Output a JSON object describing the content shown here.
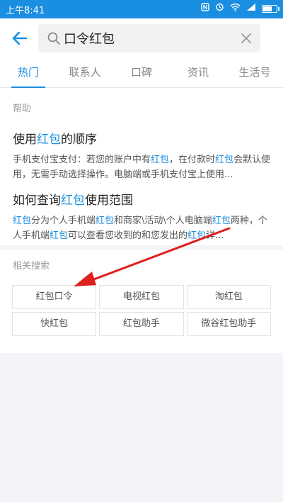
{
  "status_bar": {
    "time": "上午8:41",
    "icons": [
      "nfc-icon",
      "alarm-icon",
      "wifi-icon",
      "signal-icon",
      "battery-icon"
    ],
    "battery_level": 0.7
  },
  "search": {
    "query": "口令红包",
    "icon": "search-icon"
  },
  "tabs": [
    {
      "label": "热门",
      "active": true
    },
    {
      "label": "联系人"
    },
    {
      "label": "口碑"
    },
    {
      "label": "资讯"
    },
    {
      "label": "生活号"
    }
  ],
  "help": {
    "label": "帮助",
    "articles": [
      {
        "title_pre": "使用",
        "title_hl": "红包",
        "title_post": "的顺序",
        "desc": [
          {
            "t": "手机支付宝支付：若您的账户中有"
          },
          {
            "t": "红包",
            "hl": true
          },
          {
            "t": "，在付款时"
          },
          {
            "t": "红包",
            "hl": true
          },
          {
            "t": "会默认使用，无需手动选择操作。电脑端或手机支付宝上使用..."
          }
        ]
      },
      {
        "title_pre": "如何查询",
        "title_hl": "红包",
        "title_post": "使用范围",
        "desc": [
          {
            "t": "红包",
            "hl": true
          },
          {
            "t": "分为个人手机端"
          },
          {
            "t": "红包",
            "hl": true
          },
          {
            "t": "和商家\\活动\\个人电脑端"
          },
          {
            "t": "红包",
            "hl": true
          },
          {
            "t": "两种，个人手机端"
          },
          {
            "t": "红包",
            "hl": true
          },
          {
            "t": "可以查看您收到的和您发出的"
          },
          {
            "t": "红包",
            "hl": true
          },
          {
            "t": "详..."
          }
        ]
      }
    ]
  },
  "related": {
    "label": "相关搜索",
    "items": [
      "红包口令",
      "电视红包",
      "淘红包",
      "快红包",
      "红包助手",
      "微谷红包助手"
    ]
  },
  "colors": {
    "accent": "#1a8ee0",
    "annotation_arrow": "#e0201e"
  }
}
